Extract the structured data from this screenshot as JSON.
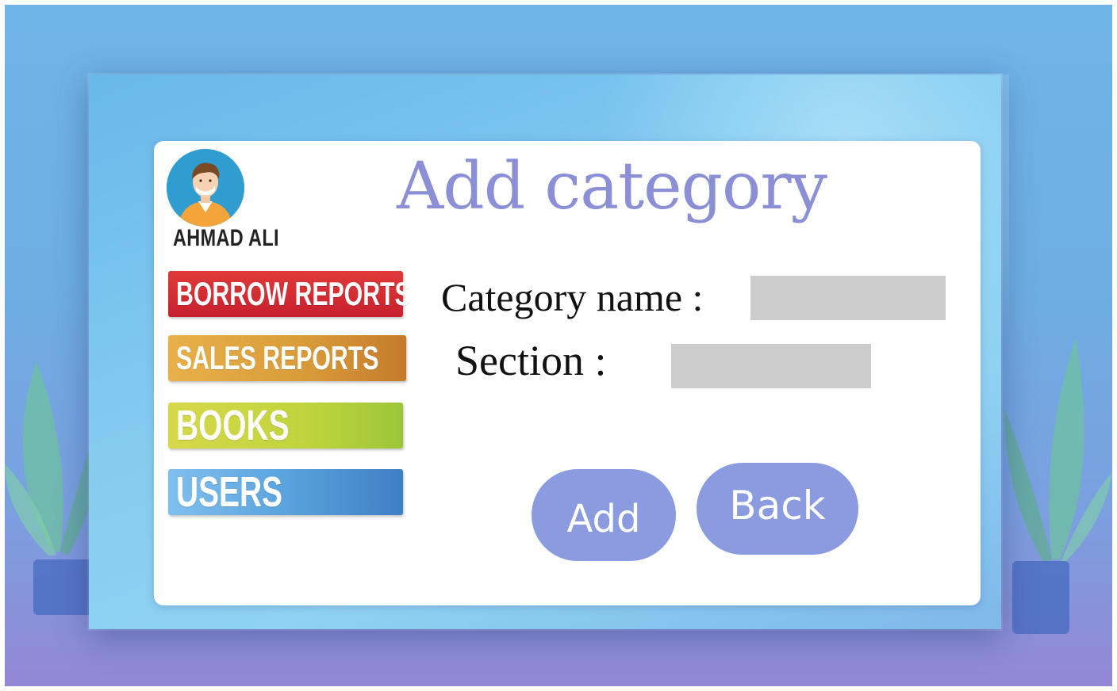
{
  "user": {
    "name": "AHMAD ALI"
  },
  "sidebar": {
    "items": [
      {
        "label": "BORROW REPORTS"
      },
      {
        "label": "SALES REPORTS"
      },
      {
        "label": "BOOKS"
      },
      {
        "label": "USERS"
      }
    ]
  },
  "page": {
    "title": "Add category"
  },
  "form": {
    "category_name_label": "Category name :",
    "category_name_value": "",
    "section_label": "Section :",
    "section_value": ""
  },
  "actions": {
    "add_label": "Add",
    "back_label": "Back"
  },
  "colors": {
    "title": "#8b90d6",
    "button": "#8a9be0",
    "field": "#cccccc",
    "borrow_reports": "#d42e34",
    "sales_reports": "#d99a38",
    "books": "#bfd43c",
    "users": "#5aa3de"
  },
  "icons": {
    "avatar": "user-avatar-icon"
  }
}
